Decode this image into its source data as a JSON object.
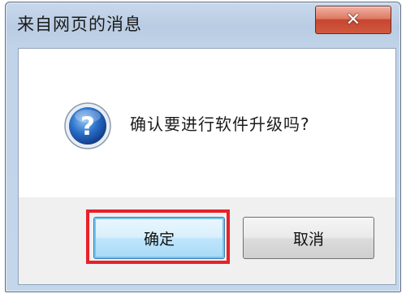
{
  "dialog": {
    "title": "来自网页的消息",
    "message": "确认要进行软件升级吗?",
    "message_icon": "question-icon",
    "close_icon": "close-icon"
  },
  "buttons": {
    "ok_label": "确定",
    "cancel_label": "取消"
  },
  "colors": {
    "highlight": "#e8202a",
    "close_button": "#c74530",
    "focused_button_border": "#3c7fb1"
  }
}
